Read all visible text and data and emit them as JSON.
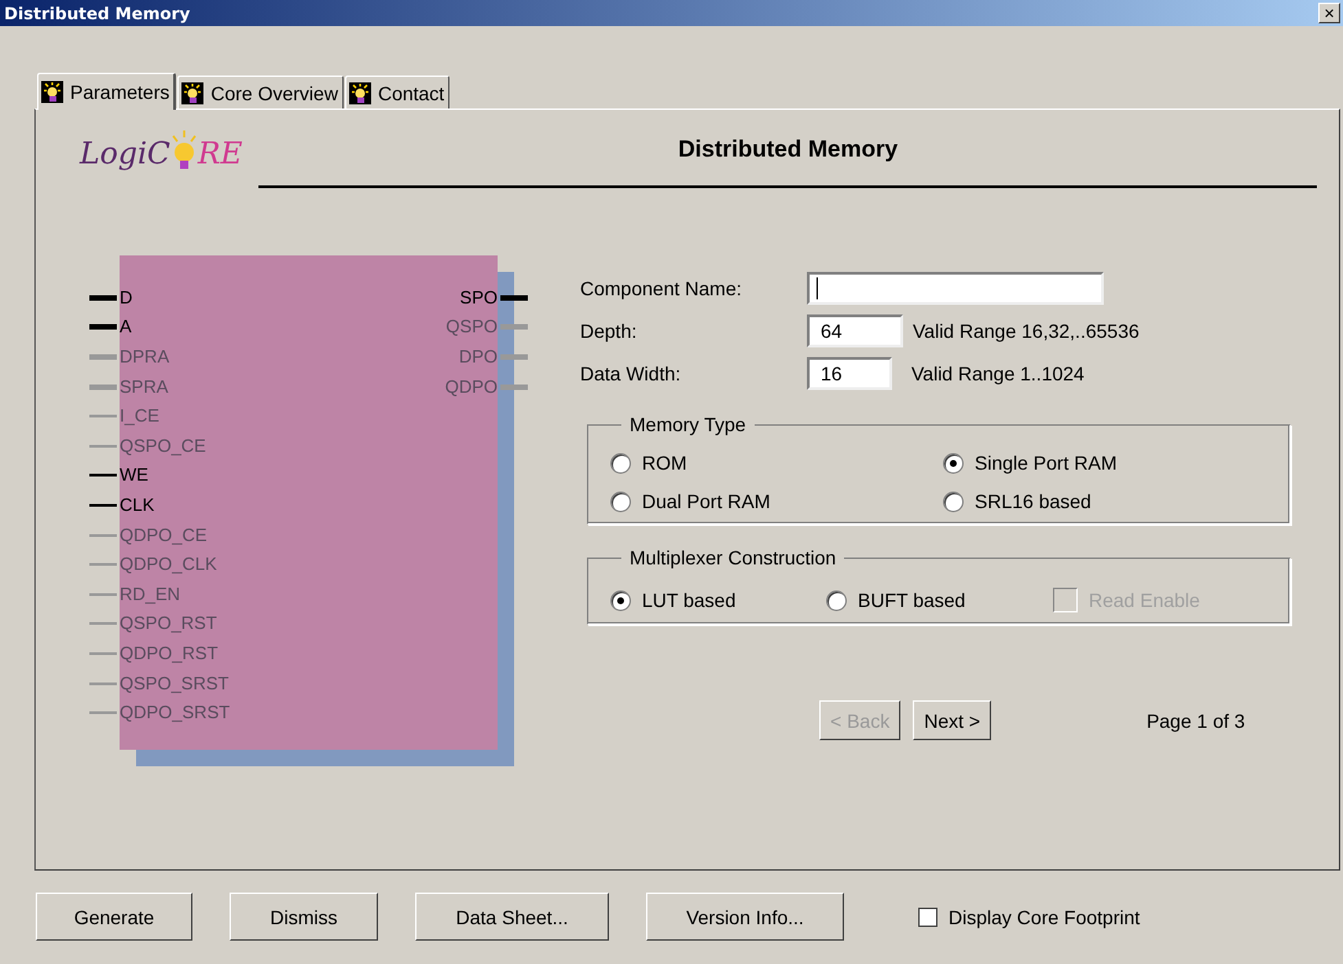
{
  "window": {
    "title": "Distributed Memory",
    "close": "×"
  },
  "tabs": [
    {
      "label": "Parameters",
      "selected": true
    },
    {
      "label": "Core Overview",
      "selected": false
    },
    {
      "label": "Contact",
      "selected": false
    }
  ],
  "logo": {
    "text_before": "LogiC",
    "text_after": "RE"
  },
  "heading": "Distributed Memory",
  "diagram": {
    "inputs": [
      {
        "label": "D",
        "active": true,
        "kind": "bus"
      },
      {
        "label": "A",
        "active": true,
        "kind": "bus"
      },
      {
        "label": "DPRA",
        "active": false,
        "kind": "bus"
      },
      {
        "label": "SPRA",
        "active": false,
        "kind": "bus"
      },
      {
        "label": "I_CE",
        "active": false,
        "kind": "single"
      },
      {
        "label": "QSPO_CE",
        "active": false,
        "kind": "single"
      },
      {
        "label": "WE",
        "active": true,
        "kind": "single"
      },
      {
        "label": "CLK",
        "active": true,
        "kind": "single"
      },
      {
        "label": "QDPO_CE",
        "active": false,
        "kind": "single"
      },
      {
        "label": "QDPO_CLK",
        "active": false,
        "kind": "single"
      },
      {
        "label": "RD_EN",
        "active": false,
        "kind": "single"
      },
      {
        "label": "QSPO_RST",
        "active": false,
        "kind": "single"
      },
      {
        "label": "QDPO_RST",
        "active": false,
        "kind": "single"
      },
      {
        "label": "QSPO_SRST",
        "active": false,
        "kind": "single"
      },
      {
        "label": "QDPO_SRST",
        "active": false,
        "kind": "single"
      }
    ],
    "outputs": [
      {
        "label": "SPO",
        "active": true,
        "kind": "bus"
      },
      {
        "label": "QSPO",
        "active": false,
        "kind": "bus"
      },
      {
        "label": "DPO",
        "active": false,
        "kind": "bus"
      },
      {
        "label": "QDPO",
        "active": false,
        "kind": "bus"
      }
    ]
  },
  "fields": [
    {
      "label": "Component Name:",
      "focused": true
    },
    {
      "label": "Depth:",
      "value": "64",
      "range": "Valid Range 16,32,..65536"
    },
    {
      "label": "Data Width:",
      "value": "16",
      "range": "Valid Range 1..1024"
    }
  ],
  "memory_type": {
    "title": "Memory Type",
    "options": [
      {
        "label": "ROM",
        "selected": false
      },
      {
        "label": "Single Port RAM",
        "selected": true
      },
      {
        "label": "Dual Port RAM",
        "selected": false
      },
      {
        "label": "SRL16 based",
        "selected": false
      }
    ]
  },
  "multiplexer": {
    "title": "Multiplexer Construction",
    "options": [
      {
        "label": "LUT based",
        "kind": "radio",
        "selected": true
      },
      {
        "label": "BUFT based",
        "kind": "radio",
        "selected": false
      },
      {
        "label": "Read Enable",
        "kind": "checkbox",
        "checked": false,
        "disabled": true
      }
    ]
  },
  "nav": {
    "buttons": [
      {
        "label": "< Back",
        "disabled": true
      },
      {
        "label": "Next >",
        "disabled": false
      }
    ],
    "page": "Page 1 of 3"
  },
  "footer": {
    "buttons": [
      "Generate",
      "Dismiss",
      "Data Sheet...",
      "Version Info..."
    ],
    "checkbox": {
      "label": "Display Core Footprint",
      "checked": false
    }
  }
}
